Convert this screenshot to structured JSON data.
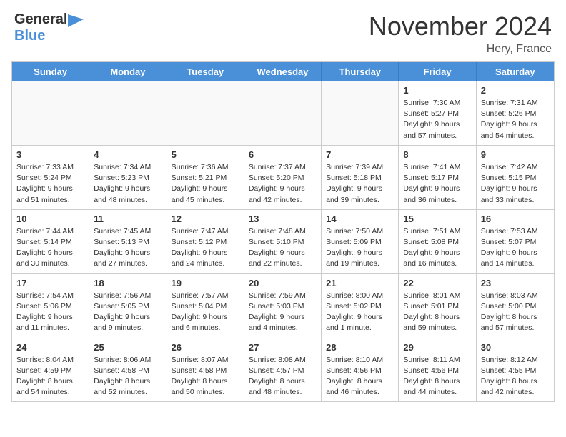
{
  "header": {
    "logo_general": "General",
    "logo_blue": "Blue",
    "month_title": "November 2024",
    "location": "Hery, France"
  },
  "days_of_week": [
    "Sunday",
    "Monday",
    "Tuesday",
    "Wednesday",
    "Thursday",
    "Friday",
    "Saturday"
  ],
  "weeks": [
    [
      {
        "num": "",
        "empty": true
      },
      {
        "num": "",
        "empty": true
      },
      {
        "num": "",
        "empty": true
      },
      {
        "num": "",
        "empty": true
      },
      {
        "num": "",
        "empty": true
      },
      {
        "num": "1",
        "info": "Sunrise: 7:30 AM\nSunset: 5:27 PM\nDaylight: 9 hours and 57 minutes."
      },
      {
        "num": "2",
        "info": "Sunrise: 7:31 AM\nSunset: 5:26 PM\nDaylight: 9 hours and 54 minutes."
      }
    ],
    [
      {
        "num": "3",
        "info": "Sunrise: 7:33 AM\nSunset: 5:24 PM\nDaylight: 9 hours and 51 minutes."
      },
      {
        "num": "4",
        "info": "Sunrise: 7:34 AM\nSunset: 5:23 PM\nDaylight: 9 hours and 48 minutes."
      },
      {
        "num": "5",
        "info": "Sunrise: 7:36 AM\nSunset: 5:21 PM\nDaylight: 9 hours and 45 minutes."
      },
      {
        "num": "6",
        "info": "Sunrise: 7:37 AM\nSunset: 5:20 PM\nDaylight: 9 hours and 42 minutes."
      },
      {
        "num": "7",
        "info": "Sunrise: 7:39 AM\nSunset: 5:18 PM\nDaylight: 9 hours and 39 minutes."
      },
      {
        "num": "8",
        "info": "Sunrise: 7:41 AM\nSunset: 5:17 PM\nDaylight: 9 hours and 36 minutes."
      },
      {
        "num": "9",
        "info": "Sunrise: 7:42 AM\nSunset: 5:15 PM\nDaylight: 9 hours and 33 minutes."
      }
    ],
    [
      {
        "num": "10",
        "info": "Sunrise: 7:44 AM\nSunset: 5:14 PM\nDaylight: 9 hours and 30 minutes."
      },
      {
        "num": "11",
        "info": "Sunrise: 7:45 AM\nSunset: 5:13 PM\nDaylight: 9 hours and 27 minutes."
      },
      {
        "num": "12",
        "info": "Sunrise: 7:47 AM\nSunset: 5:12 PM\nDaylight: 9 hours and 24 minutes."
      },
      {
        "num": "13",
        "info": "Sunrise: 7:48 AM\nSunset: 5:10 PM\nDaylight: 9 hours and 22 minutes."
      },
      {
        "num": "14",
        "info": "Sunrise: 7:50 AM\nSunset: 5:09 PM\nDaylight: 9 hours and 19 minutes."
      },
      {
        "num": "15",
        "info": "Sunrise: 7:51 AM\nSunset: 5:08 PM\nDaylight: 9 hours and 16 minutes."
      },
      {
        "num": "16",
        "info": "Sunrise: 7:53 AM\nSunset: 5:07 PM\nDaylight: 9 hours and 14 minutes."
      }
    ],
    [
      {
        "num": "17",
        "info": "Sunrise: 7:54 AM\nSunset: 5:06 PM\nDaylight: 9 hours and 11 minutes."
      },
      {
        "num": "18",
        "info": "Sunrise: 7:56 AM\nSunset: 5:05 PM\nDaylight: 9 hours and 9 minutes."
      },
      {
        "num": "19",
        "info": "Sunrise: 7:57 AM\nSunset: 5:04 PM\nDaylight: 9 hours and 6 minutes."
      },
      {
        "num": "20",
        "info": "Sunrise: 7:59 AM\nSunset: 5:03 PM\nDaylight: 9 hours and 4 minutes."
      },
      {
        "num": "21",
        "info": "Sunrise: 8:00 AM\nSunset: 5:02 PM\nDaylight: 9 hours and 1 minute."
      },
      {
        "num": "22",
        "info": "Sunrise: 8:01 AM\nSunset: 5:01 PM\nDaylight: 8 hours and 59 minutes."
      },
      {
        "num": "23",
        "info": "Sunrise: 8:03 AM\nSunset: 5:00 PM\nDaylight: 8 hours and 57 minutes."
      }
    ],
    [
      {
        "num": "24",
        "info": "Sunrise: 8:04 AM\nSunset: 4:59 PM\nDaylight: 8 hours and 54 minutes."
      },
      {
        "num": "25",
        "info": "Sunrise: 8:06 AM\nSunset: 4:58 PM\nDaylight: 8 hours and 52 minutes."
      },
      {
        "num": "26",
        "info": "Sunrise: 8:07 AM\nSunset: 4:58 PM\nDaylight: 8 hours and 50 minutes."
      },
      {
        "num": "27",
        "info": "Sunrise: 8:08 AM\nSunset: 4:57 PM\nDaylight: 8 hours and 48 minutes."
      },
      {
        "num": "28",
        "info": "Sunrise: 8:10 AM\nSunset: 4:56 PM\nDaylight: 8 hours and 46 minutes."
      },
      {
        "num": "29",
        "info": "Sunrise: 8:11 AM\nSunset: 4:56 PM\nDaylight: 8 hours and 44 minutes."
      },
      {
        "num": "30",
        "info": "Sunrise: 8:12 AM\nSunset: 4:55 PM\nDaylight: 8 hours and 42 minutes."
      }
    ]
  ]
}
